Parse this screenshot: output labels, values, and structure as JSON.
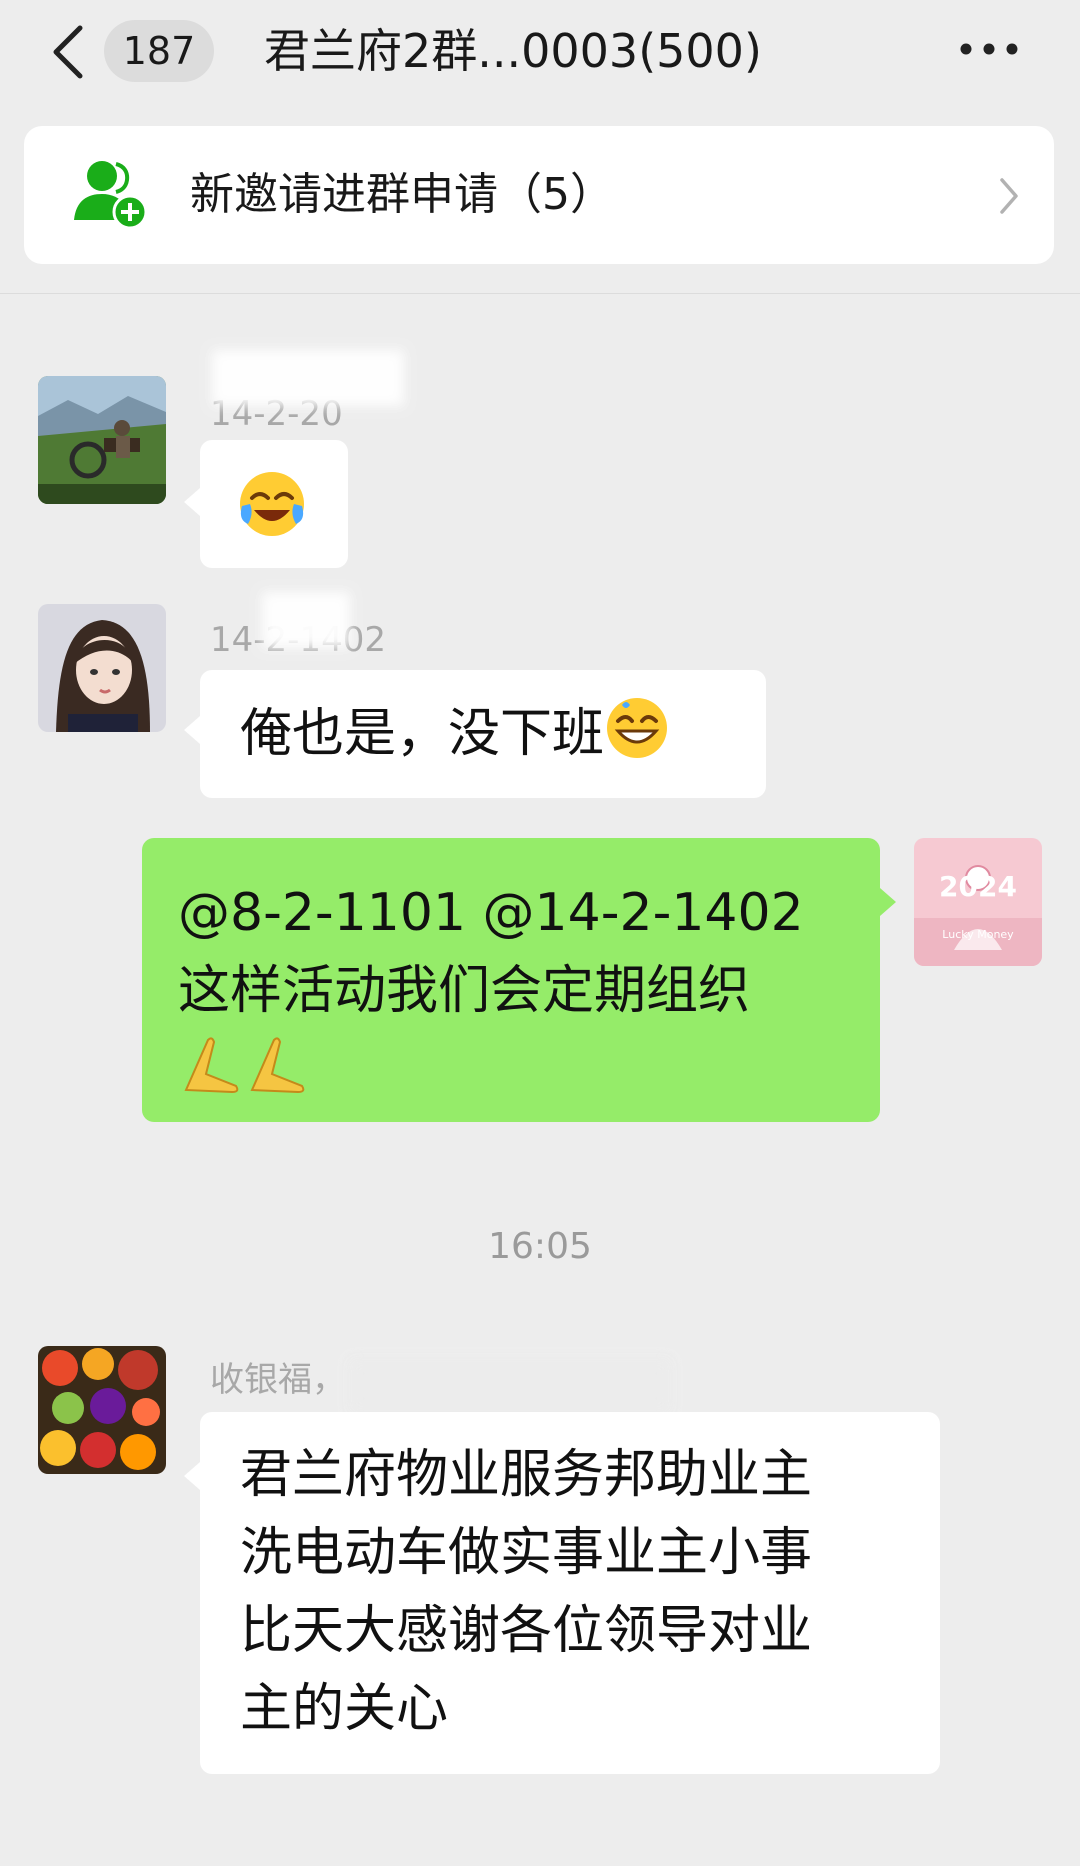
{
  "header": {
    "unread_count": "187",
    "title": "君兰府2群...0003(500)",
    "back_icon": "chevron-left-icon",
    "more_icon": "more-dots-icon"
  },
  "notice": {
    "text": "新邀请进群申请（5）",
    "icon": "group-add-icon",
    "icon_color": "#1aad19"
  },
  "messages": [
    {
      "sender": "14-2-20",
      "text": "",
      "emoji": "face-with-tears-of-joy"
    },
    {
      "sender": "14-2-1402",
      "text": "俺也是，没下班",
      "emoji": "grinning-face-with-sweat"
    },
    {
      "sender": "",
      "lines": [
        "@8-2-1101 @14-2-1402",
        "这样活动我们会定期组织"
      ],
      "emoji": "pray-hands",
      "avatar_text": "2024",
      "avatar_caption": "Lucky Money",
      "bubble_color": "#95ec69"
    },
    {
      "sender": "收银福，",
      "lines": [
        "君兰府物业服务邦助业主",
        "洗电动车做实事业主小事",
        "比天大感谢各位领导对业",
        "主的关心"
      ]
    }
  ],
  "time_divider": "16:05",
  "colors": {
    "background": "#ededed",
    "bubble_self": "#95ec69",
    "bubble_other": "#ffffff"
  }
}
